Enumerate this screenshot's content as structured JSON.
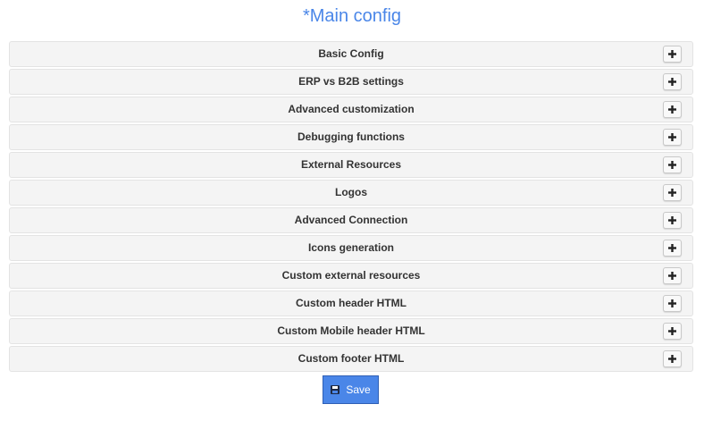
{
  "page": {
    "title": "*Main config"
  },
  "sections": [
    {
      "label": "Basic Config"
    },
    {
      "label": "ERP vs B2B settings"
    },
    {
      "label": "Advanced customization"
    },
    {
      "label": "Debugging functions"
    },
    {
      "label": "External Resources"
    },
    {
      "label": "Logos"
    },
    {
      "label": "Advanced Connection"
    },
    {
      "label": "Icons generation"
    },
    {
      "label": "Custom external resources"
    },
    {
      "label": "Custom header HTML"
    },
    {
      "label": "Custom Mobile header HTML"
    },
    {
      "label": "Custom footer HTML"
    }
  ],
  "expand_icon": "plus-icon",
  "save": {
    "label": "Save",
    "icon": "floppy-disk-icon"
  },
  "colors": {
    "accent": "#4a86e8",
    "panel_background": "#f4f4f4",
    "label_text": "#333333"
  }
}
